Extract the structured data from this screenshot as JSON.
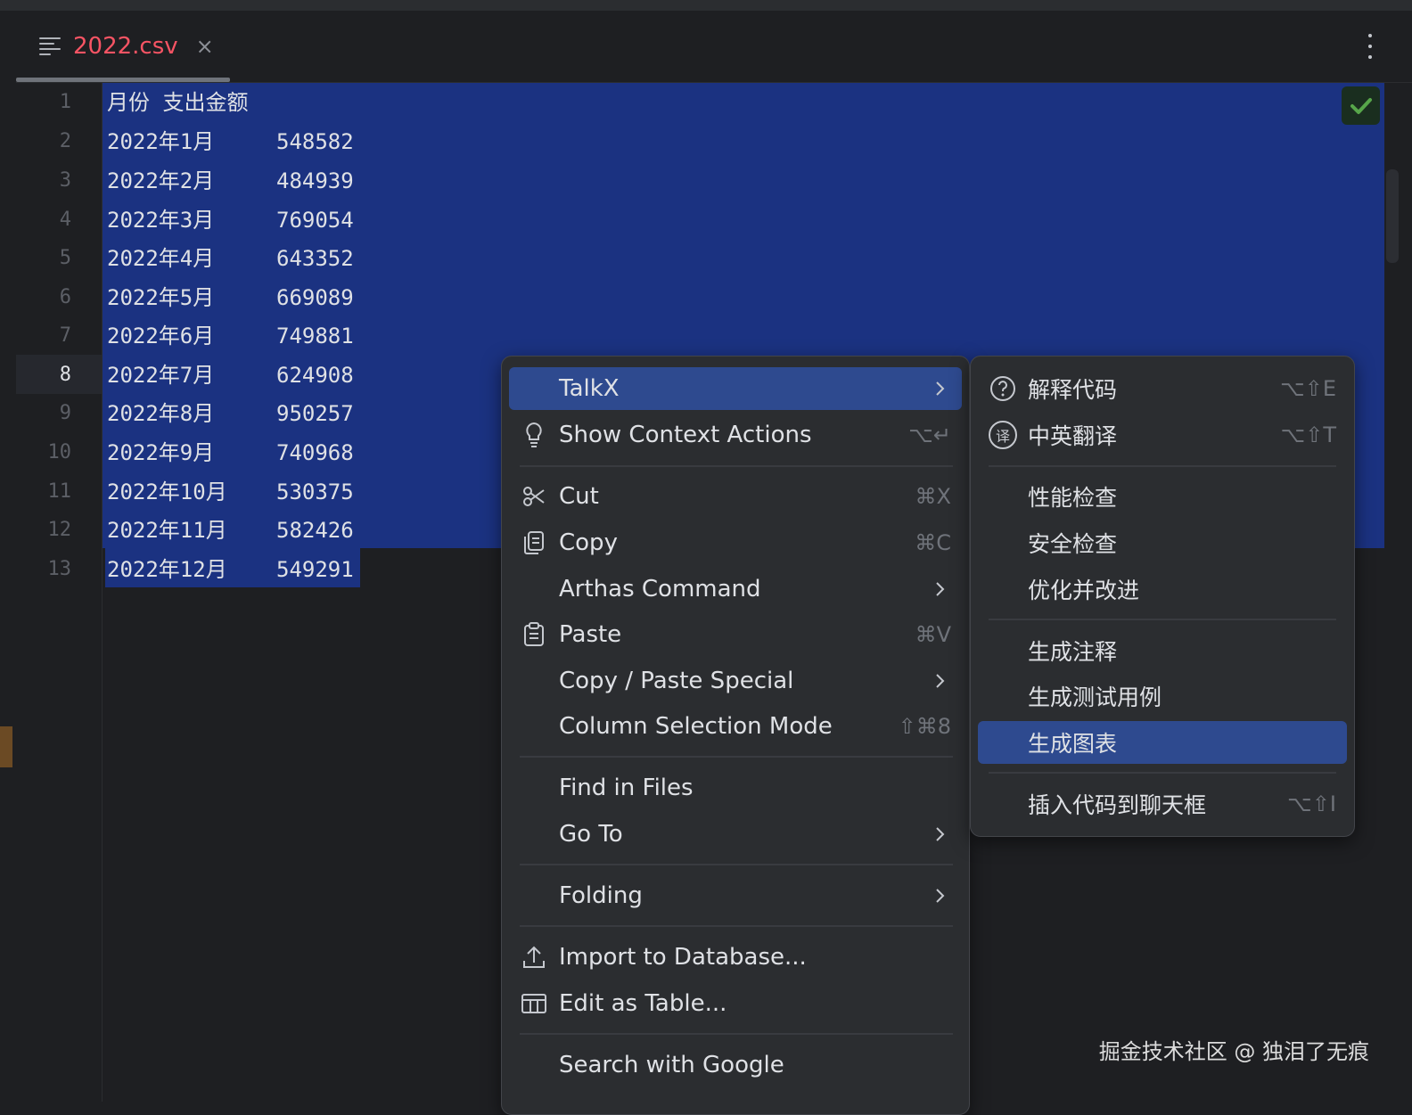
{
  "tab": {
    "title": "2022.csv",
    "close_glyph": "×",
    "file_icon": "text-file-icon",
    "more_icon": "kebab-menu-icon"
  },
  "editor": {
    "current_line": 8,
    "lines": [
      {
        "num": "1",
        "c1": "月份 支出金额",
        "c2": ""
      },
      {
        "num": "2",
        "c1": "2022年1月",
        "c2": "548582"
      },
      {
        "num": "3",
        "c1": "2022年2月",
        "c2": "484939"
      },
      {
        "num": "4",
        "c1": "2022年3月",
        "c2": "769054"
      },
      {
        "num": "5",
        "c1": "2022年4月",
        "c2": "643352"
      },
      {
        "num": "6",
        "c1": "2022年5月",
        "c2": "669089"
      },
      {
        "num": "7",
        "c1": "2022年6月",
        "c2": "749881"
      },
      {
        "num": "8",
        "c1": "2022年7月",
        "c2": "624908"
      },
      {
        "num": "9",
        "c1": "2022年8月",
        "c2": "950257"
      },
      {
        "num": "10",
        "c1": "2022年9月",
        "c2": "740968"
      },
      {
        "num": "11",
        "c1": "2022年10月",
        "c2": "530375"
      },
      {
        "num": "12",
        "c1": "2022年11月",
        "c2": "582426"
      },
      {
        "num": "13",
        "c1": "2022年12月",
        "c2": "549291"
      }
    ],
    "inspection_icon": "check-icon"
  },
  "context_menu": {
    "talkx": {
      "label": "TalkX"
    },
    "show_context_actions": {
      "label": "Show Context Actions",
      "shortcut": "⌥↵"
    },
    "cut": {
      "label": "Cut",
      "shortcut": "⌘X"
    },
    "copy": {
      "label": "Copy",
      "shortcut": "⌘C"
    },
    "arthas": {
      "label": "Arthas Command"
    },
    "paste": {
      "label": "Paste",
      "shortcut": "⌘V"
    },
    "copy_paste_special": {
      "label": "Copy / Paste Special"
    },
    "column_selection": {
      "label": "Column Selection Mode",
      "shortcut": "⇧⌘8"
    },
    "find_in_files": {
      "label": "Find in Files"
    },
    "go_to": {
      "label": "Go To"
    },
    "folding": {
      "label": "Folding"
    },
    "import_db": {
      "label": "Import to Database..."
    },
    "edit_table": {
      "label": "Edit as Table..."
    },
    "search_google": {
      "label": "Search with Google"
    }
  },
  "talkx_submenu": {
    "explain": {
      "label": "解释代码",
      "shortcut": "⌥⇧E"
    },
    "translate": {
      "label": "中英翻译",
      "shortcut": "⌥⇧T",
      "icon_text": "译"
    },
    "performance": {
      "label": "性能检查"
    },
    "security": {
      "label": "安全检查"
    },
    "optimize": {
      "label": "优化并改进"
    },
    "gen_comment": {
      "label": "生成注释"
    },
    "gen_test": {
      "label": "生成测试用例"
    },
    "gen_chart": {
      "label": "生成图表"
    },
    "insert_chat": {
      "label": "插入代码到聊天框",
      "shortcut": "⌥⇧I"
    }
  },
  "watermark": "掘金技术社区 @ 独泪了无痕",
  "colors": {
    "selection": "#1b3281",
    "menu_bg": "#2b2d30",
    "highlight": "#2e4a8f",
    "tab_title": "#f75464"
  }
}
